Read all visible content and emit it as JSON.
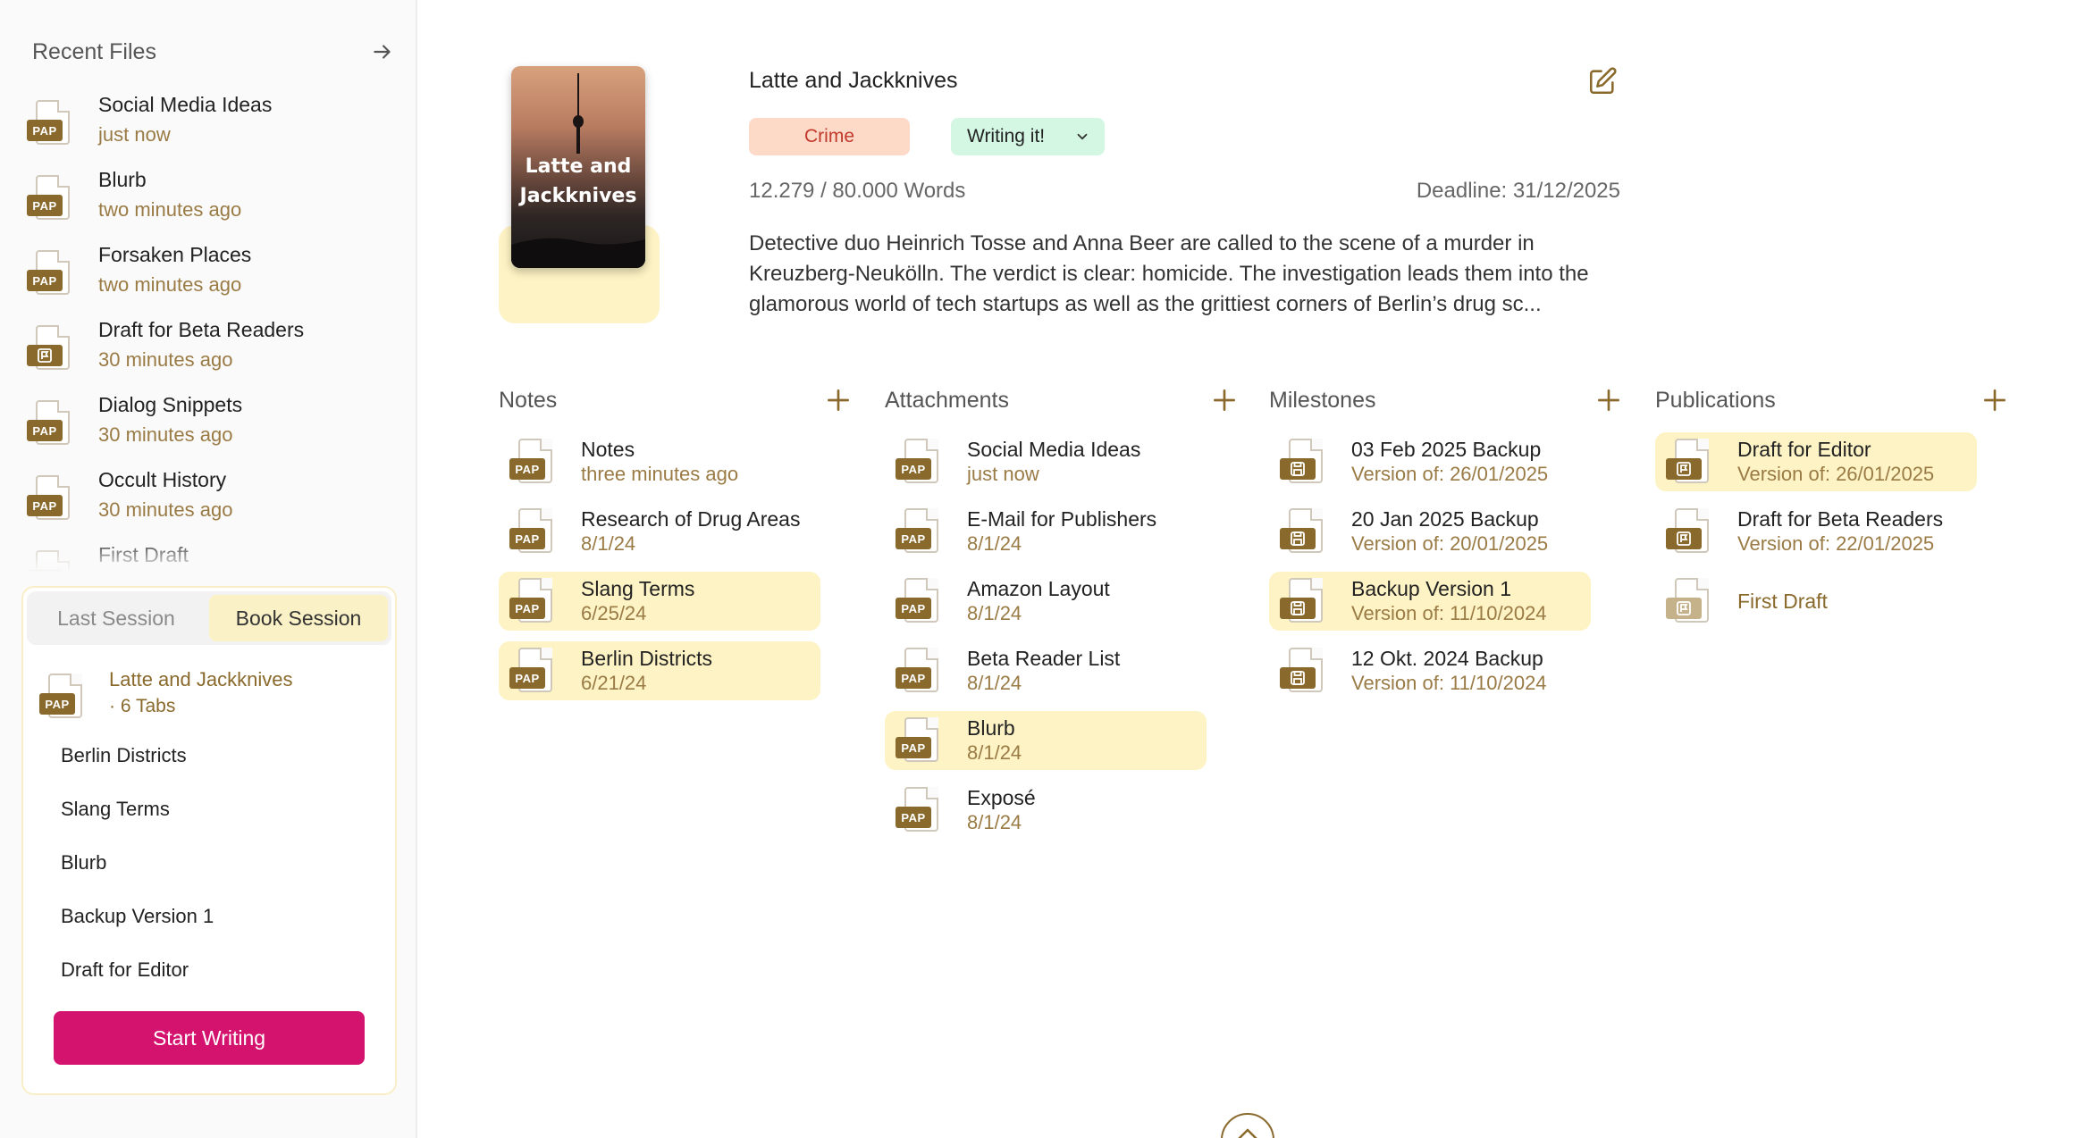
{
  "sidebar": {
    "title": "Recent Files",
    "recent": [
      {
        "name": "Social Media Ideas",
        "time": "just now",
        "icon": "pap-file-icon"
      },
      {
        "name": "Blurb",
        "time": "two minutes ago",
        "icon": "pap-file-icon"
      },
      {
        "name": "Forsaken Places",
        "time": "two minutes ago",
        "icon": "pap-file-icon"
      },
      {
        "name": "Draft for Beta Readers",
        "time": "30 minutes ago",
        "icon": "flag-file-icon"
      },
      {
        "name": "Dialog Snippets",
        "time": "30 minutes ago",
        "icon": "pap-file-icon"
      },
      {
        "name": "Occult History",
        "time": "30 minutes ago",
        "icon": "pap-file-icon"
      },
      {
        "name": "First Draft",
        "time": "",
        "icon": "pap-file-icon"
      }
    ],
    "session": {
      "tabs": [
        "Last Session",
        "Book Session"
      ],
      "active_tab": "Book Session",
      "book_name": "Latte and Jackknives",
      "book_tabs": "· 6 Tabs",
      "items": [
        "Berlin Districts",
        "Slang Terms",
        "Blurb",
        "Backup Version 1",
        "Draft for Editor"
      ],
      "start_label": "Start Writing"
    }
  },
  "book": {
    "cover_title": "Latte and Jackknives",
    "title": "Latte and Jackknives",
    "genre": "Crime",
    "status": "Writing it!",
    "words": "12.279 / 80.000 Words",
    "deadline": "Deadline: 31/12/2025",
    "description": "Detective duo Heinrich Tosse and Anna Beer are called to the scene of a murder in Kreuzberg-Neukölln. The verdict is clear: homicide. The investigation leads them into the glamorous world of tech startups as well as the grittiest corners of Berlin’s drug sc..."
  },
  "columns": {
    "notes": {
      "title": "Notes",
      "items": [
        {
          "name": "Notes",
          "sub": "three minutes ago",
          "highlight": false
        },
        {
          "name": "Research of Drug Areas",
          "sub": "8/1/24",
          "highlight": false
        },
        {
          "name": "Slang Terms",
          "sub": "6/25/24",
          "highlight": true
        },
        {
          "name": "Berlin Districts",
          "sub": "6/21/24",
          "highlight": true
        }
      ]
    },
    "attachments": {
      "title": "Attachments",
      "items": [
        {
          "name": "Social Media Ideas",
          "sub": "just now",
          "highlight": false
        },
        {
          "name": "E-Mail for Publishers",
          "sub": "8/1/24",
          "highlight": false
        },
        {
          "name": "Amazon Layout",
          "sub": "8/1/24",
          "highlight": false
        },
        {
          "name": "Beta Reader List",
          "sub": "8/1/24",
          "highlight": false
        },
        {
          "name": "Blurb",
          "sub": "8/1/24",
          "highlight": true
        },
        {
          "name": "Exposé",
          "sub": "8/1/24",
          "highlight": false
        }
      ]
    },
    "milestones": {
      "title": "Milestones",
      "items": [
        {
          "name": "03 Feb 2025 Backup",
          "sub": "Version of: 26/01/2025",
          "highlight": false
        },
        {
          "name": "20 Jan 2025 Backup",
          "sub": "Version of: 20/01/2025",
          "highlight": false
        },
        {
          "name": "Backup Version 1",
          "sub": "Version of: 11/10/2024",
          "highlight": true
        },
        {
          "name": "12 Okt. 2024 Backup",
          "sub": "Version of: 11/10/2024",
          "highlight": false
        }
      ]
    },
    "publications": {
      "title": "Publications",
      "items": [
        {
          "name": "Draft for Editor",
          "sub": "Version of: 26/01/2025",
          "highlight": true
        },
        {
          "name": "Draft for Beta Readers",
          "sub": "Version of: 22/01/2025",
          "highlight": false
        },
        {
          "name": "First Draft",
          "sub": "",
          "highlight": false
        }
      ]
    }
  },
  "colors": {
    "accent": "#8a6a2c",
    "highlight": "#fdf3c4",
    "primary_button": "#d4136f",
    "genre_bg": "#fdd9c8",
    "status_bg": "#d4f7e4"
  }
}
